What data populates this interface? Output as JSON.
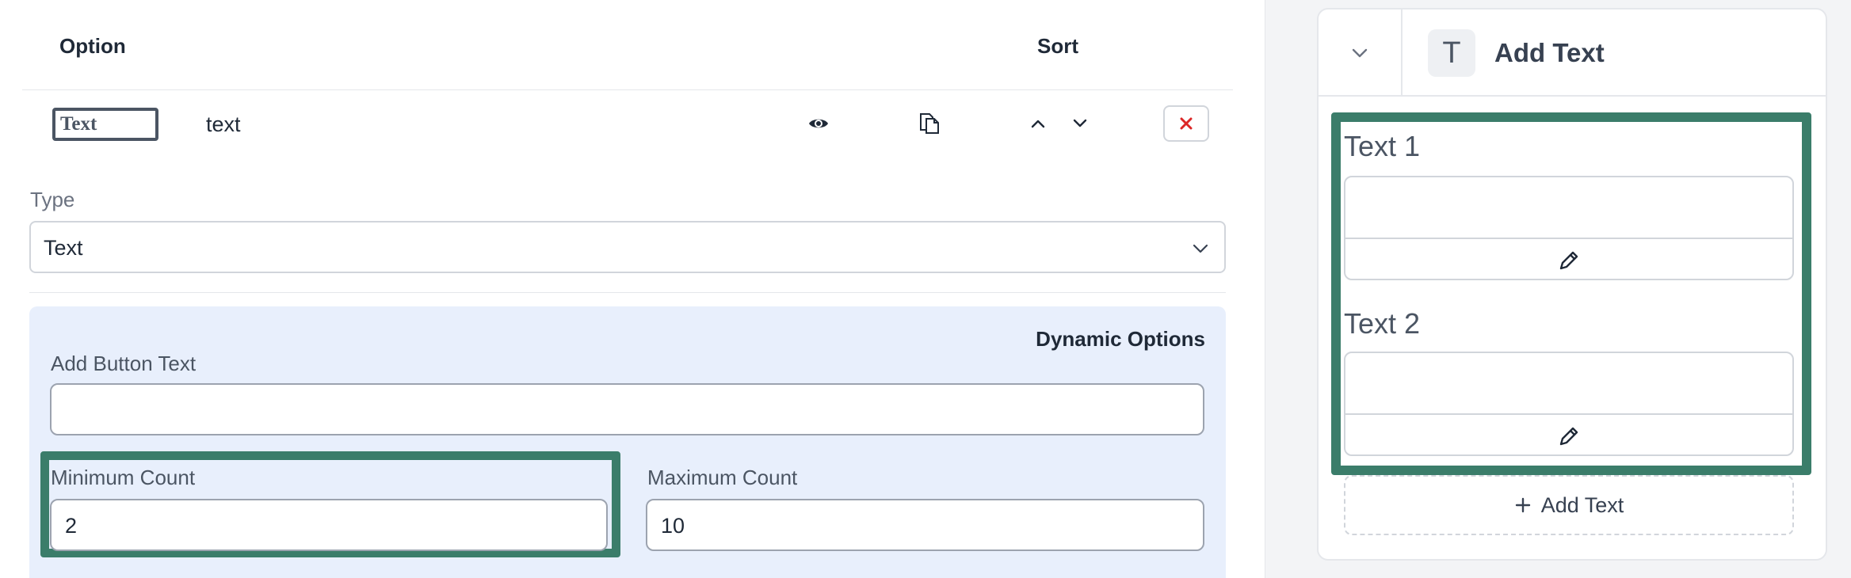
{
  "table": {
    "header_option": "Option",
    "header_sort": "Sort",
    "row": {
      "thumb_text": "Text",
      "name": "text"
    }
  },
  "type_field": {
    "label": "Type",
    "value": "Text"
  },
  "dynamic_options": {
    "title": "Dynamic Options",
    "add_button_text_label": "Add Button Text",
    "add_button_text_value": "",
    "minimum_count_label": "Minimum Count",
    "minimum_count_value": "2",
    "maximum_count_label": "Maximum Count",
    "maximum_count_value": "10"
  },
  "preview": {
    "title": "Add Text",
    "badge_letter": "T",
    "fields": [
      {
        "label": "Text 1"
      },
      {
        "label": "Text 2"
      }
    ],
    "add_button_label": "Add Text"
  },
  "colors": {
    "highlight": "#3b7d6a",
    "delete_icon": "#dc2626",
    "dynamic_panel_bg": "#e8effc"
  }
}
